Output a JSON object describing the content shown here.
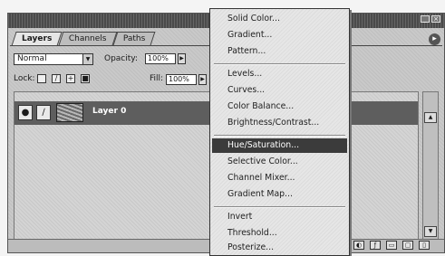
{
  "palette": {
    "tabs": [
      "Layers",
      "Channels",
      "Paths"
    ],
    "blend_mode": "Normal",
    "opacity_label": "Opacity:",
    "opacity_value": "100%",
    "lock_label": "Lock:",
    "fill_label": "Fill:",
    "fill_value": "100%",
    "layers": [
      {
        "name": "Layer 0",
        "selected": true,
        "visible": true
      }
    ]
  },
  "menu": {
    "groups": [
      [
        "Solid Color...",
        "Gradient...",
        "Pattern..."
      ],
      [
        "Levels...",
        "Curves...",
        "Color Balance...",
        "Brightness/Contrast..."
      ],
      [
        "Hue/Saturation...",
        "Selective Color...",
        "Channel Mixer...",
        "Gradient Map..."
      ],
      [
        "Invert",
        "Threshold...",
        "Posterize..."
      ]
    ],
    "selected_item": "Hue/Saturation..."
  },
  "colors": {
    "selection": "#3b3b3b",
    "title_bar": "#4a4a4a"
  }
}
